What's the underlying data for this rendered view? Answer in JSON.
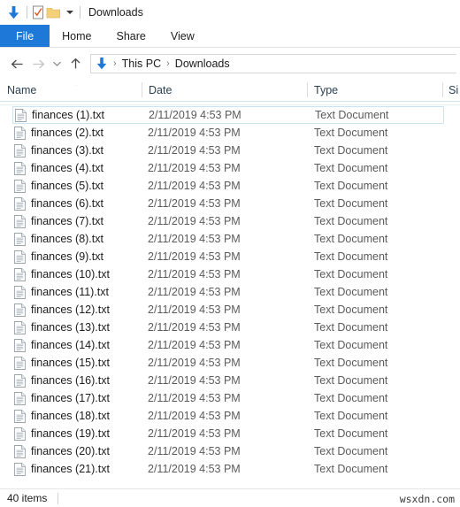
{
  "window": {
    "title": "Downloads",
    "quick_access": [
      {
        "name": "downloads-arrow-icon",
        "label": "Downloads"
      },
      {
        "name": "properties-icon",
        "label": "Properties"
      },
      {
        "name": "new-folder-icon",
        "label": "New folder"
      },
      {
        "name": "customize-quick-access-icon",
        "label": "Customize Quick Access Toolbar"
      }
    ]
  },
  "ribbon": {
    "tabs": [
      {
        "label": "File",
        "active": true
      },
      {
        "label": "Home",
        "active": false
      },
      {
        "label": "Share",
        "active": false
      },
      {
        "label": "View",
        "active": false
      }
    ]
  },
  "address_bar": {
    "back_label": "Back",
    "forward_label": "Forward",
    "recent_label": "Recent locations",
    "up_label": "Up",
    "breadcrumb": [
      "This PC",
      "Downloads"
    ],
    "separator": "›"
  },
  "columns": [
    {
      "label": "Name",
      "sorted": "asc"
    },
    {
      "label": "Date",
      "sorted": ""
    },
    {
      "label": "Type",
      "sorted": ""
    },
    {
      "label": "Si",
      "sorted": ""
    }
  ],
  "files": [
    {
      "name": "finances (1).txt",
      "date": "2/11/2019 4:53 PM",
      "type": "Text Document",
      "selected": true
    },
    {
      "name": "finances (2).txt",
      "date": "2/11/2019 4:53 PM",
      "type": "Text Document",
      "selected": false
    },
    {
      "name": "finances (3).txt",
      "date": "2/11/2019 4:53 PM",
      "type": "Text Document",
      "selected": false
    },
    {
      "name": "finances (4).txt",
      "date": "2/11/2019 4:53 PM",
      "type": "Text Document",
      "selected": false
    },
    {
      "name": "finances (5).txt",
      "date": "2/11/2019 4:53 PM",
      "type": "Text Document",
      "selected": false
    },
    {
      "name": "finances (6).txt",
      "date": "2/11/2019 4:53 PM",
      "type": "Text Document",
      "selected": false
    },
    {
      "name": "finances (7).txt",
      "date": "2/11/2019 4:53 PM",
      "type": "Text Document",
      "selected": false
    },
    {
      "name": "finances (8).txt",
      "date": "2/11/2019 4:53 PM",
      "type": "Text Document",
      "selected": false
    },
    {
      "name": "finances (9).txt",
      "date": "2/11/2019 4:53 PM",
      "type": "Text Document",
      "selected": false
    },
    {
      "name": "finances (10).txt",
      "date": "2/11/2019 4:53 PM",
      "type": "Text Document",
      "selected": false
    },
    {
      "name": "finances (11).txt",
      "date": "2/11/2019 4:53 PM",
      "type": "Text Document",
      "selected": false
    },
    {
      "name": "finances (12).txt",
      "date": "2/11/2019 4:53 PM",
      "type": "Text Document",
      "selected": false
    },
    {
      "name": "finances (13).txt",
      "date": "2/11/2019 4:53 PM",
      "type": "Text Document",
      "selected": false
    },
    {
      "name": "finances (14).txt",
      "date": "2/11/2019 4:53 PM",
      "type": "Text Document",
      "selected": false
    },
    {
      "name": "finances (15).txt",
      "date": "2/11/2019 4:53 PM",
      "type": "Text Document",
      "selected": false
    },
    {
      "name": "finances (16).txt",
      "date": "2/11/2019 4:53 PM",
      "type": "Text Document",
      "selected": false
    },
    {
      "name": "finances (17).txt",
      "date": "2/11/2019 4:53 PM",
      "type": "Text Document",
      "selected": false
    },
    {
      "name": "finances (18).txt",
      "date": "2/11/2019 4:53 PM",
      "type": "Text Document",
      "selected": false
    },
    {
      "name": "finances (19).txt",
      "date": "2/11/2019 4:53 PM",
      "type": "Text Document",
      "selected": false
    },
    {
      "name": "finances (20).txt",
      "date": "2/11/2019 4:53 PM",
      "type": "Text Document",
      "selected": false
    },
    {
      "name": "finances (21).txt",
      "date": "2/11/2019 4:53 PM",
      "type": "Text Document",
      "selected": false
    }
  ],
  "status": {
    "item_count": "40 items"
  },
  "watermark": {
    "text": "wsxdn.com"
  },
  "colors": {
    "accent": "#1e78d7",
    "folder": "#f5d07a",
    "text": "#1b1b1b",
    "muted": "#5a5a5a",
    "header_text": "#2a3f52"
  }
}
